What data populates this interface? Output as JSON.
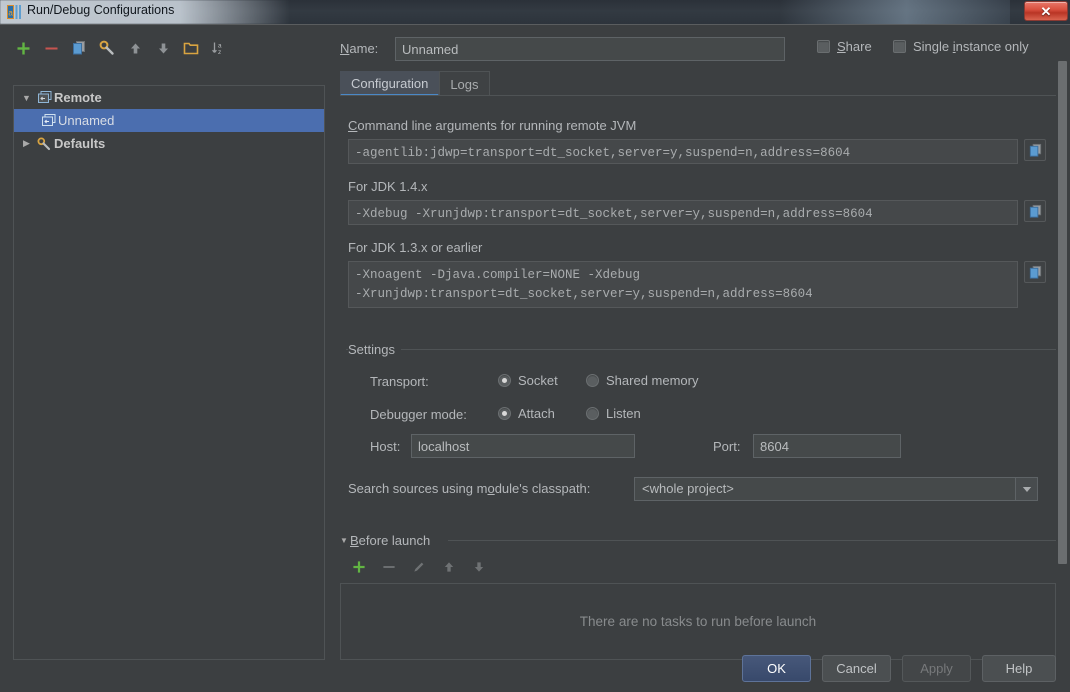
{
  "window": {
    "title": "Run/Debug Configurations",
    "app_icon": "idea-icon",
    "close_label": "✕"
  },
  "toolbar": {
    "buttons": [
      {
        "name": "add-configuration-button",
        "icon": "plus-icon",
        "tooltip": "Add New Configuration"
      },
      {
        "name": "remove-configuration-button",
        "icon": "minus-icon",
        "tooltip": "Remove Configuration"
      },
      {
        "name": "copy-configuration-button",
        "icon": "copy-icon",
        "tooltip": "Copy Configuration"
      },
      {
        "name": "edit-defaults-button",
        "icon": "wrench-icon",
        "tooltip": "Edit defaults"
      },
      {
        "name": "move-up-button",
        "icon": "arrow-up-icon",
        "tooltip": "Move Up"
      },
      {
        "name": "move-down-button",
        "icon": "arrow-down-icon",
        "tooltip": "Move Down"
      },
      {
        "name": "create-folder-button",
        "icon": "folder-icon",
        "tooltip": "Create New Folder"
      },
      {
        "name": "sort-button",
        "icon": "sort-alpha-icon",
        "tooltip": "Sort Configurations"
      }
    ]
  },
  "tree": {
    "items": [
      {
        "label": "Remote",
        "icon": "remote-icon",
        "arrow": "▼",
        "bold": true,
        "selected": false,
        "indent": 0
      },
      {
        "label": "Unnamed",
        "icon": "remote-icon",
        "arrow": "",
        "bold": false,
        "selected": true,
        "indent": 1
      },
      {
        "label": "Defaults",
        "icon": "wrench-icon",
        "arrow": "▶",
        "bold": true,
        "selected": false,
        "indent": 0
      }
    ]
  },
  "form": {
    "name_label": "Name:",
    "name_mnemonic": "N",
    "name_value": "Unnamed",
    "share_label": "Share",
    "share_checked": false,
    "single_instance_label": "Single instance only",
    "single_instance_checked": false
  },
  "tabs": [
    {
      "label": "Configuration",
      "active": true
    },
    {
      "label": "Logs",
      "active": false
    }
  ],
  "fields": {
    "cmdline_label": "Command line arguments for running remote JVM",
    "cmdline_value": "-agentlib:jdwp=transport=dt_socket,server=y,suspend=n,address=8604",
    "jdk14_label": "For JDK 1.4.x",
    "jdk14_value": "-Xdebug -Xrunjdwp:transport=dt_socket,server=y,suspend=n,address=8604",
    "jdk13_label": "For JDK 1.3.x or earlier",
    "jdk13_value": "-Xnoagent -Djava.compiler=NONE -Xdebug\n-Xrunjdwp:transport=dt_socket,server=y,suspend=n,address=8604",
    "copy_icon": "copy-icon"
  },
  "settings": {
    "group_label": "Settings",
    "transport_label": "Transport:",
    "transport_options": [
      {
        "label": "Socket",
        "checked": true
      },
      {
        "label": "Shared memory",
        "checked": false
      }
    ],
    "debugger_mode_label": "Debugger mode:",
    "debugger_mode_options": [
      {
        "label": "Attach",
        "checked": true
      },
      {
        "label": "Listen",
        "checked": false
      }
    ],
    "host_label": "Host:",
    "host_value": "localhost",
    "port_label": "Port:",
    "port_value": "8604",
    "classpath_label": "Search sources using module's classpath:",
    "classpath_value": "<whole project>",
    "classpath_arrow": "▼"
  },
  "before_launch": {
    "section_label": "Before launch",
    "collapse_arrow": "▼",
    "empty_message": "There are no tasks to run before launch",
    "buttons": [
      {
        "name": "add-task-button",
        "icon": "plus-icon"
      },
      {
        "name": "remove-task-button",
        "icon": "minus-icon"
      },
      {
        "name": "edit-task-button",
        "icon": "pencil-icon"
      },
      {
        "name": "task-move-up-button",
        "icon": "arrow-up-icon"
      },
      {
        "name": "task-move-down-button",
        "icon": "arrow-down-icon"
      }
    ]
  },
  "dialog_buttons": [
    {
      "label": "OK",
      "name": "ok-button",
      "style": "default",
      "enabled": true
    },
    {
      "label": "Cancel",
      "name": "cancel-button",
      "style": "normal",
      "enabled": true
    },
    {
      "label": "Apply",
      "name": "apply-button",
      "style": "disabled",
      "enabled": false
    },
    {
      "label": "Help",
      "name": "help-button",
      "style": "normal",
      "enabled": true
    }
  ],
  "colors": {
    "background": "#3c3f41",
    "selection": "#4b6eaf",
    "accent": "#4a88c7",
    "field_bg": "#45494a",
    "text": "#b4b7ba",
    "add_green": "#62b543",
    "remove_red": "#c75450"
  }
}
